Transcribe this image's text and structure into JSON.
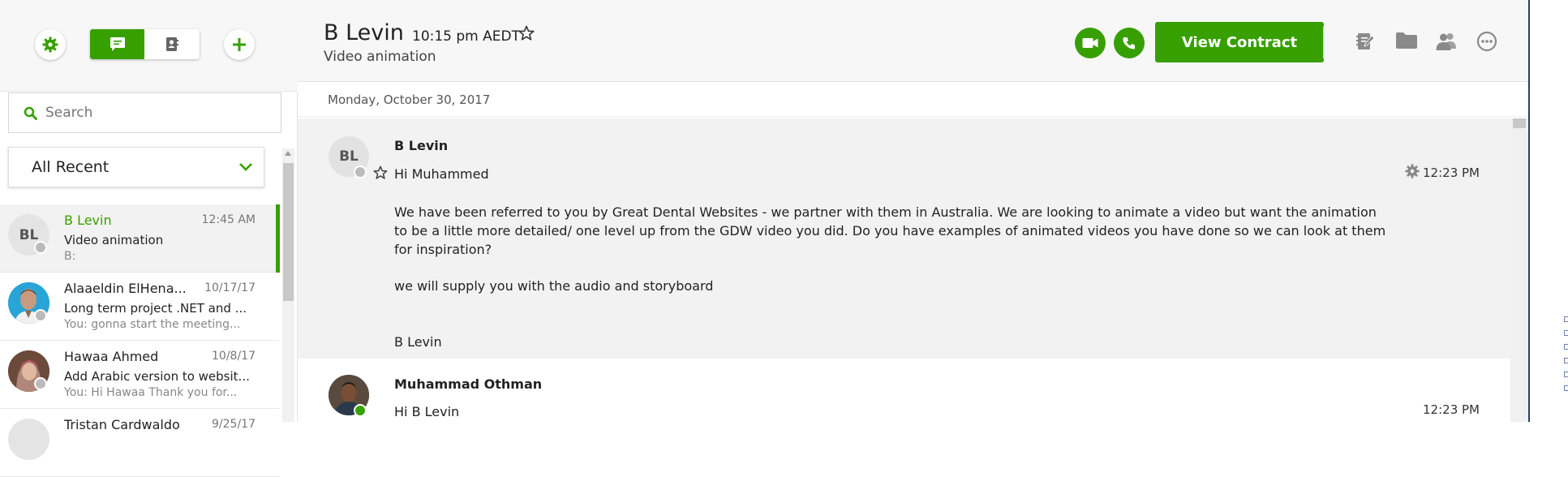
{
  "sidebar": {
    "search_placeholder": "Search",
    "filter_label": "All Recent",
    "conversations": [
      {
        "initials": "BL",
        "name": "B Levin",
        "time": "12:45 AM",
        "subject": "Video animation",
        "preview": "B:"
      },
      {
        "name": "Alaaeldin ElHena...",
        "time": "10/17/17",
        "subject": "Long term project .NET and ...",
        "preview": "You: gonna start the meeting..."
      },
      {
        "name": "Hawaa Ahmed",
        "time": "10/8/17",
        "subject": "Add Arabic version to websit...",
        "preview": "You: Hi Hawaa Thank you for..."
      },
      {
        "name": "Tristan Cardwaldo",
        "time": "9/25/17"
      }
    ]
  },
  "header": {
    "name": "B Levin",
    "local_time": "10:15 pm AEDT",
    "subtitle": "Video animation",
    "view_contract_label": "View Contract"
  },
  "thread": {
    "date": "Monday, October 30, 2017",
    "messages": [
      {
        "initials": "BL",
        "sender": "B Levin",
        "time": "12:23 PM",
        "greeting": "Hi Muhammed",
        "body1": "We have been referred to you by Great Dental Websites - we partner with them in Australia. We are looking to animate a video but want the animation to be a little more detailed/ one level up from the GDW video you did. Do you have examples of animated videos you have done so we can look at them for inspiration?",
        "body2": "we will supply you with the audio and storyboard",
        "signature": "B Levin"
      },
      {
        "sender": "Muhammad Othman",
        "time": "12:23 PM",
        "greeting": "Hi B Levin"
      }
    ]
  },
  "colors": {
    "accent": "#37a000",
    "selected_bg": "#f2f2f2",
    "offline": "#bbbbbb",
    "online": "#37a000"
  },
  "icons": [
    "settings-icon",
    "chat-icon",
    "contacts-icon",
    "plus-icon",
    "search-icon",
    "chevron-down-icon",
    "star-icon",
    "video-call-icon",
    "phone-icon",
    "notepad-icon",
    "folder-icon",
    "people-icon",
    "more-icon",
    "gear-icon"
  ]
}
